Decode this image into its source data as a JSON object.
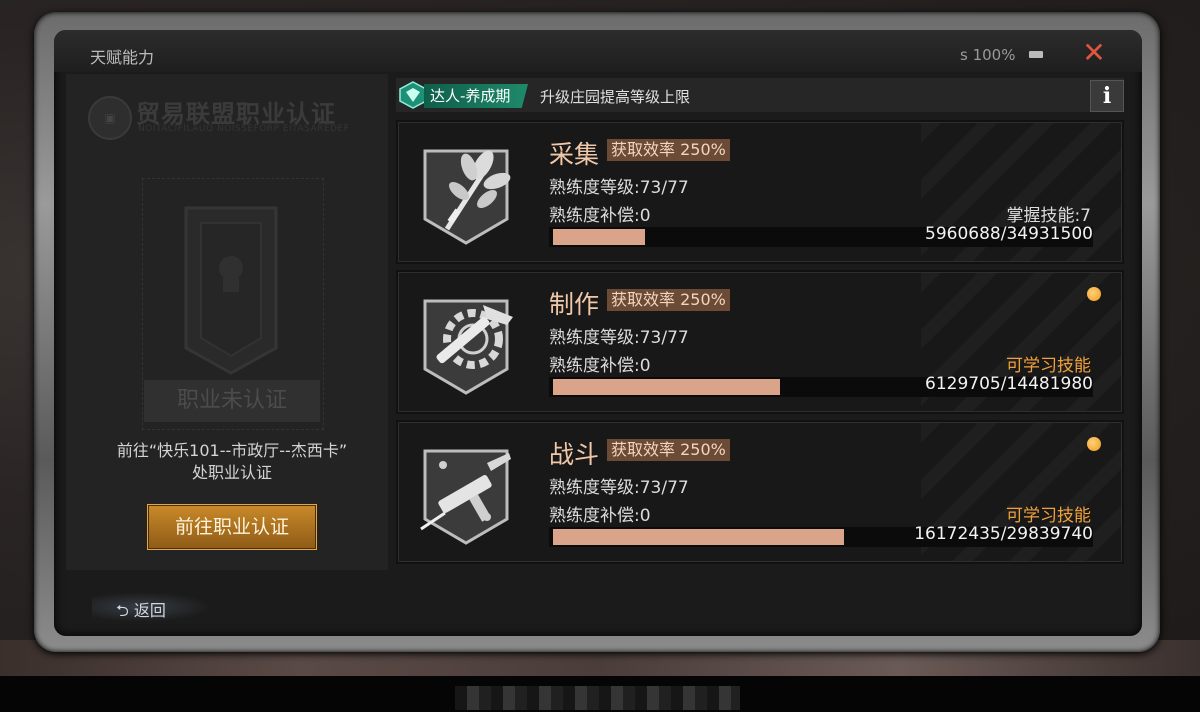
{
  "window": {
    "title": "天赋能力",
    "status_text": "s 100%",
    "close_glyph": "✕"
  },
  "left_panel": {
    "logo_badge": "▣",
    "logo_title": "贸易联盟职业认证",
    "logo_subtitle": "NOITACIFILAUQ NOISSEFORP EITASAREDEF",
    "cert_status": "职业未认证",
    "goto_text_line1": "前往“快乐101--市政厅--杰西卡”",
    "goto_text_line2": "处职业认证",
    "goto_button": "前往职业认证"
  },
  "back": {
    "glyph": "⮌",
    "label": "返回"
  },
  "header": {
    "rank": "达人-养成期",
    "desc": "升级庄园提高等级上限",
    "info_glyph": "i"
  },
  "accent": {
    "progress": "#d9a489",
    "rank_green": "#1e8a6a",
    "close_red": "#e0553f",
    "notify_dot": "#f09a1a",
    "skill_orange": "#f2a13a"
  },
  "cards": [
    {
      "icon": "leaf-bundle-icon",
      "name": "采集",
      "rate": "获取效率 250%",
      "level": "熟练度等级:73/77",
      "compensation": "熟练度补偿:0",
      "skill": "掌握技能:7",
      "skill_highlight": false,
      "xp": "5960688/34931500",
      "progress": 0.171,
      "notify": false
    },
    {
      "icon": "gear-hammer-icon",
      "name": "制作",
      "rate": "获取效率 250%",
      "level": "熟练度等级:73/77",
      "compensation": "熟练度补偿:0",
      "skill": "可学习技能",
      "skill_highlight": true,
      "xp": "6129705/14481980",
      "progress": 0.423,
      "notify": true
    },
    {
      "icon": "gun-icon",
      "name": "战斗",
      "rate": "获取效率 250%",
      "level": "熟练度等级:73/77",
      "compensation": "熟练度补偿:0",
      "skill": "可学习技能",
      "skill_highlight": true,
      "xp": "16172435/29839740",
      "progress": 0.542,
      "notify": true
    }
  ]
}
